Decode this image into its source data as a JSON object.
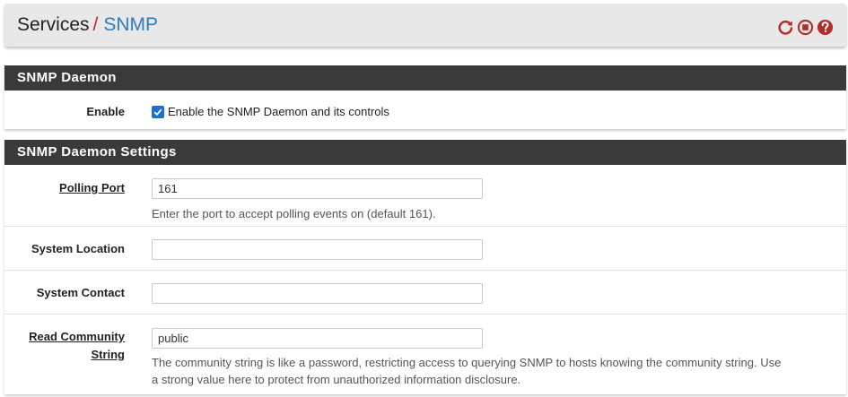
{
  "header": {
    "breadcrumb_first": "Services",
    "breadcrumb_sep": "/",
    "breadcrumb_current": "SNMP",
    "icons": [
      "reload-icon",
      "stop-icon",
      "help-icon"
    ]
  },
  "daemon_panel": {
    "title": "SNMP Daemon",
    "enable_label": "Enable",
    "enable_checkbox_label": "Enable the SNMP Daemon and its controls",
    "enable_checked": true
  },
  "settings_panel": {
    "title": "SNMP Daemon Settings",
    "polling_port": {
      "label": "Polling Port",
      "value": "161",
      "help": "Enter the port to accept polling events on (default 161)."
    },
    "system_location": {
      "label": "System Location",
      "value": ""
    },
    "system_contact": {
      "label": "System Contact",
      "value": ""
    },
    "read_community": {
      "label_line1": "Read Community",
      "label_line2": "String",
      "value": "public",
      "help_line1": "The community string is like a password, restricting access to querying SNMP to hosts knowing the community string. Use",
      "help_line2": "a strong value here to protect from unauthorized information disclosure."
    }
  },
  "colors": {
    "accent": "#2f7bbf",
    "separator": "#b52b27",
    "panel_heading": "#3a3a3a",
    "icon_red": "#b52b27",
    "checkbox": "#1e6fcf"
  }
}
